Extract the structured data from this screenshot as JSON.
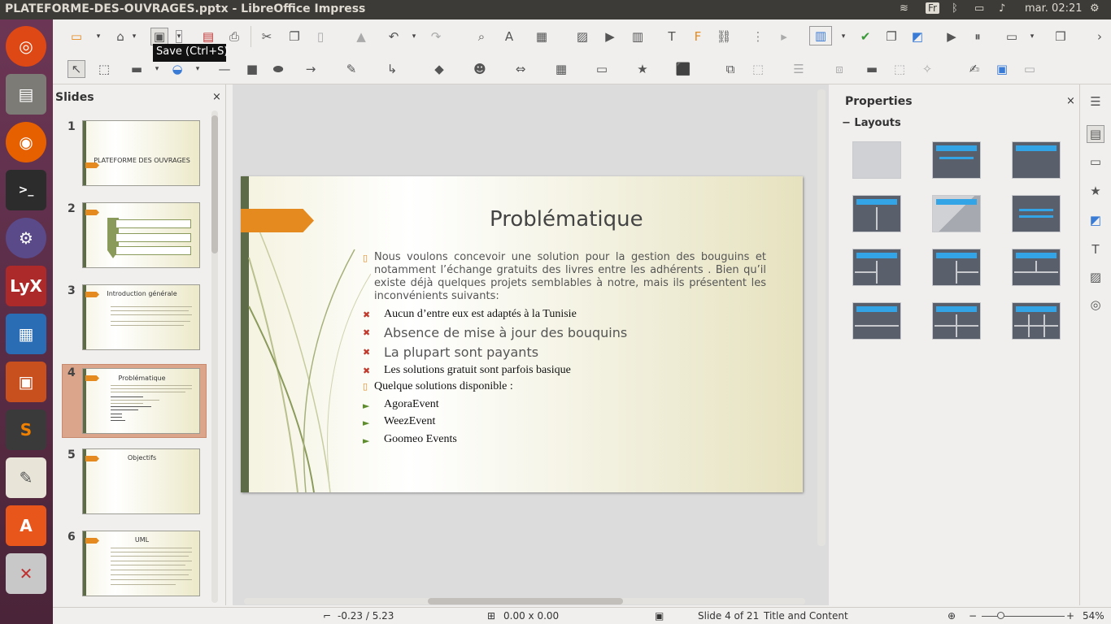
{
  "window": {
    "title": "PLATEFORME-DES-OUVRAGES.pptx - LibreOffice Impress"
  },
  "indicators": {
    "keyboard": "Fr",
    "clock": "mar. 02:21"
  },
  "tooltip": "Save (Ctrl+S)",
  "slides_panel": {
    "title": "Slides",
    "slides": [
      {
        "num": "1",
        "title": "PLATEFORME DES OUVRAGES"
      },
      {
        "num": "2",
        "title": ""
      },
      {
        "num": "3",
        "title": "Introduction générale"
      },
      {
        "num": "4",
        "title": "Problématique"
      },
      {
        "num": "5",
        "title": "Objectifs"
      },
      {
        "num": "6",
        "title": "UML"
      }
    ]
  },
  "slide": {
    "title": "Problématique",
    "intro": "Nous voulons concevoir une solution pour la gestion des bouguins et notamment l’échange gratuits des livres entre les adhérents . Bien qu’il existe déjà quelques projets semblables à notre, mais ils présentent les inconvénients suivants:",
    "issues": [
      "Aucun d’entre eux est adaptés à la Tunisie",
      "Absence de mise à jour des bouquins",
      "La plupart sont payants",
      "Les solutions gratuit sont parfois basique"
    ],
    "solutions_heading": "Quelque solutions disponible :",
    "solutions": [
      "AgoraEvent",
      "WeezEvent",
      "Goomeo Events"
    ]
  },
  "properties": {
    "title": "Properties",
    "section": "Layouts"
  },
  "status": {
    "position": "-0.23 / 5.23",
    "size": "0.00 x 0.00",
    "slide": "Slide 4 of 21",
    "layout": "Title and Content",
    "zoom": "54%"
  }
}
